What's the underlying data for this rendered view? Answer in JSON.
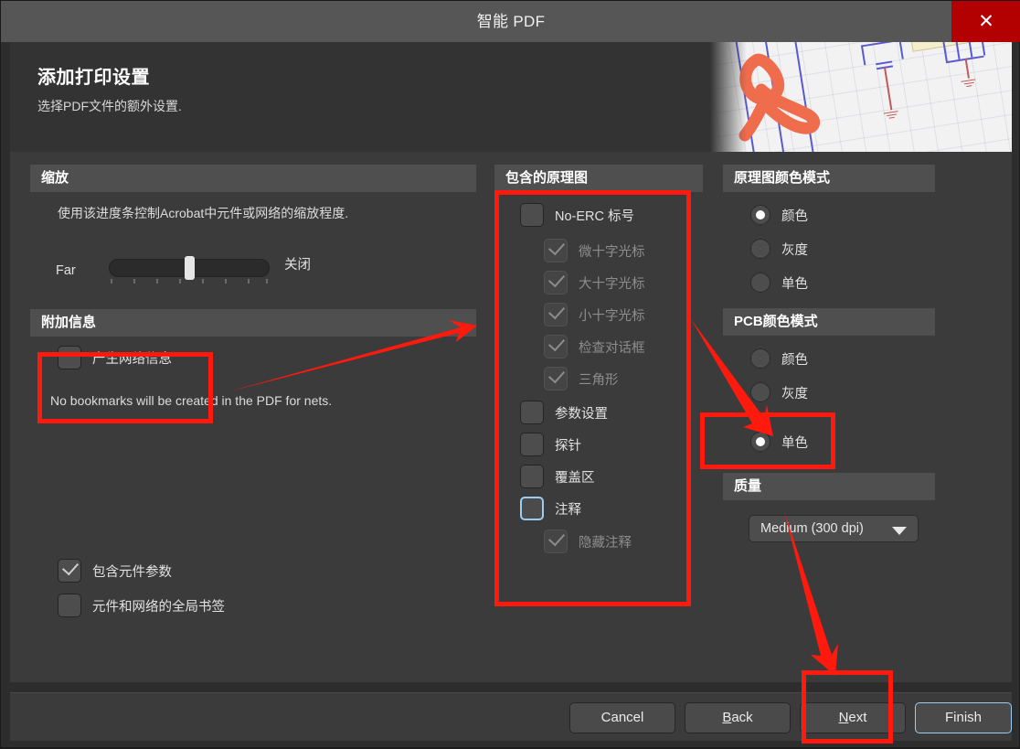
{
  "window": {
    "title": "智能 PDF",
    "close_label": "✕"
  },
  "banner": {
    "title": "添加打印设置",
    "subtitle": "选择PDF文件的额外设置."
  },
  "zoom_panel": {
    "header": "缩放",
    "description": "使用该进度条控制Acrobat中元件或网络的缩放程度.",
    "slider_min_label": "Far",
    "slider_max_label": "关闭",
    "slider_value_percent": 50
  },
  "additional_panel": {
    "header": "附加信息",
    "generate_nets_label": "产生网络信息",
    "generate_nets_checked": false,
    "hint": "No bookmarks will be created in the PDF for nets."
  },
  "bottom_options": [
    {
      "label": "包含元件参数",
      "checked": true
    },
    {
      "label": "元件和网络的全局书签",
      "checked": false
    }
  ],
  "schematic_panel": {
    "header": "包含的原理图",
    "items": [
      {
        "label": "No-ERC 标号",
        "checked": false,
        "enabled": true,
        "indent": 0,
        "focused": false
      },
      {
        "label": "微十字光标",
        "checked": true,
        "enabled": false,
        "indent": 1,
        "focused": false
      },
      {
        "label": "大十字光标",
        "checked": true,
        "enabled": false,
        "indent": 1,
        "focused": false
      },
      {
        "label": "小十字光标",
        "checked": true,
        "enabled": false,
        "indent": 1,
        "focused": false
      },
      {
        "label": "检查对话框",
        "checked": true,
        "enabled": false,
        "indent": 1,
        "focused": false
      },
      {
        "label": "三角形",
        "checked": true,
        "enabled": false,
        "indent": 1,
        "focused": false
      },
      {
        "label": "参数设置",
        "checked": false,
        "enabled": true,
        "indent": 0,
        "focused": false
      },
      {
        "label": "探针",
        "checked": false,
        "enabled": true,
        "indent": 0,
        "focused": false
      },
      {
        "label": "覆盖区",
        "checked": false,
        "enabled": true,
        "indent": 0,
        "focused": false
      },
      {
        "label": "注释",
        "checked": false,
        "enabled": true,
        "indent": 0,
        "focused": true
      },
      {
        "label": "隐藏注释",
        "checked": true,
        "enabled": false,
        "indent": 1,
        "focused": false
      }
    ]
  },
  "sch_color_panel": {
    "header": "原理图颜色模式",
    "options": [
      {
        "label": "颜色",
        "selected": true
      },
      {
        "label": "灰度",
        "selected": false
      },
      {
        "label": "单色",
        "selected": false
      }
    ]
  },
  "pcb_color_panel": {
    "header": "PCB颜色模式",
    "options": [
      {
        "label": "颜色",
        "selected": false
      },
      {
        "label": "灰度",
        "selected": false
      },
      {
        "label": "单色",
        "selected": true
      }
    ]
  },
  "quality_panel": {
    "header": "质量",
    "selected": "Medium (300 dpi)"
  },
  "footer": {
    "cancel": "Cancel",
    "back_prefix": "",
    "back_mnemonic": "B",
    "back_suffix": "ack",
    "next_prefix": "",
    "next_mnemonic": "N",
    "next_suffix": "ext",
    "finish": "Finish"
  },
  "annotations": {
    "highlight_color": "#ff1a0d",
    "boxes": [
      "nets-option-box",
      "schematic-list-box",
      "pcb-mono-option-box",
      "next-button-box"
    ],
    "arrows": [
      "arrow-to-schematic-panel",
      "arrow-to-pcb-mono",
      "arrow-to-next-button"
    ]
  }
}
